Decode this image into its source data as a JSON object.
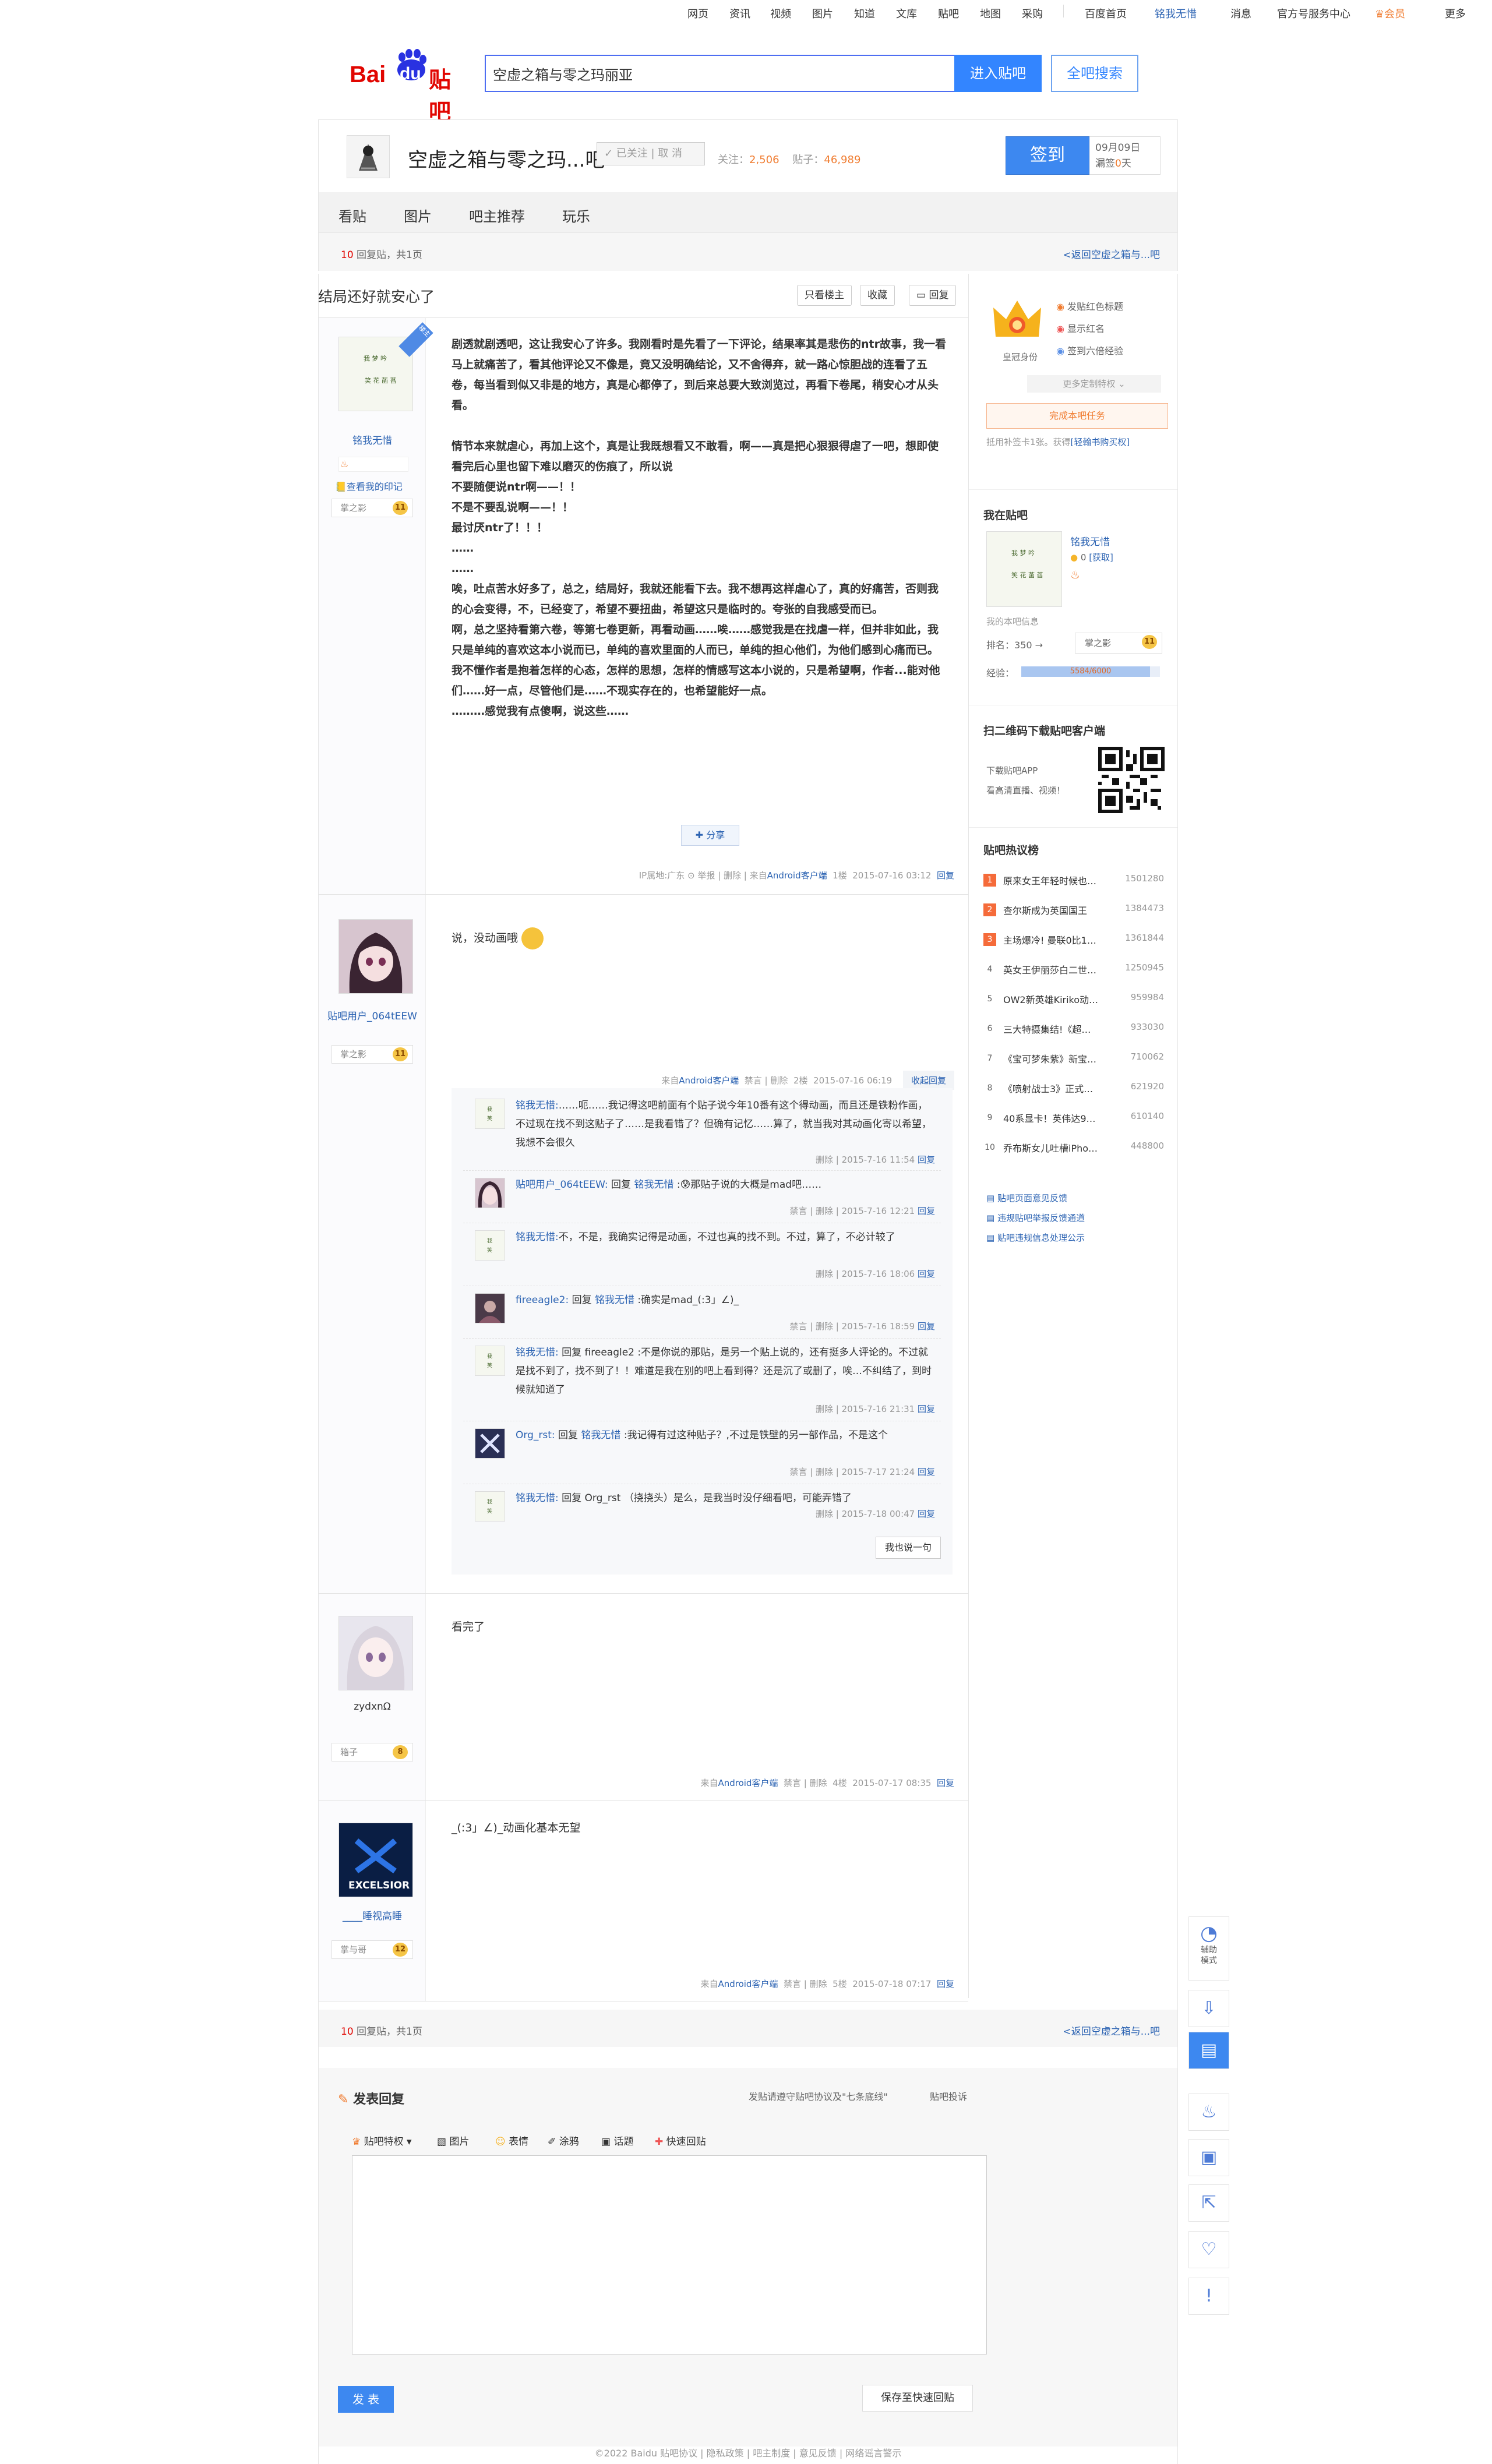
{
  "topnav": {
    "items": [
      "网页",
      "资讯",
      "视频",
      "图片",
      "知道",
      "文库",
      "贴吧",
      "地图",
      "采购"
    ],
    "right": [
      "百度首页",
      "铭我无惜",
      "消息",
      "官方号服务中心",
      "会员",
      "更多"
    ]
  },
  "header": {
    "logo_bai": "Bai",
    "logo_du": "du",
    "logo_tieba": "贴吧",
    "search_value": "空虚之箱与零之玛丽亚",
    "enter_btn": "进入贴吧",
    "all_btn": "全吧搜索"
  },
  "forum": {
    "name": "空虚之箱与零之玛...吧",
    "followed": "✓ 已关注 | 取 消",
    "follow_label": "关注：",
    "follow_count": "2,506",
    "post_label": "贴子：",
    "post_count": "46,989",
    "sign_btn": "签到",
    "sign_date": "09月09日",
    "sign_missed_prefix": "漏签",
    "sign_missed_days": "0",
    "sign_missed_suffix": "天",
    "tabs": [
      "看贴",
      "图片",
      "吧主推荐",
      "玩乐"
    ]
  },
  "pager": {
    "count_num": "10",
    "count_text": " 回复贴，共1页",
    "back": "<返回空虚之箱与...吧"
  },
  "thread": {
    "title": "结局还好就安心了",
    "btn_lz": "只看楼主",
    "btn_fav": "收藏",
    "btn_reply": "回复"
  },
  "posts": [
    {
      "user": "铭我无惜",
      "badge": "楼主",
      "diary": "查看我的印记",
      "level_name": "掌之影",
      "level": "11",
      "lines": [
        "剧透就剧透吧，这让我安心了许多。我刚看时是先看了一下评论，结果率其是悲伤的ntr故事，我一看马上就痛苦了，看其他评论又不像是，竟又没明确结论，又不舍得弃，就一路心惊胆战的连看了五卷，每当看到似又非是的地方，真是心都停了，到后来总要大致浏览过，再看下卷尾，稍安心才从头看。",
        "",
        "情节本来就虐心，再加上这个，真是让我既想看又不敢看，啊——真是把心狠狠得虐了一吧，想即使看完后心里也留下难以磨灭的伤痕了，所以说",
        "不要随便说ntr啊——！！",
        "不是不要乱说啊——！！",
        "最讨厌ntr了！！！",
        "……",
        "……",
        "唉，吐点苦水好多了，总之，结局好，我就还能看下去。我不想再这样虐心了，真的好痛苦，否则我的心会变得，不，已经变了，希望不要扭曲，希望这只是临时的。夸张的自我感受而已。",
        "啊，总之坚持看第六卷，等第七卷更新，再看动画……唉……感觉我是在找虐一样，但并非如此，我只是单纯的喜欢这本小说而已，单纯的喜欢里面的人而已，单纯的担心他们，为他们感到心痛而已。",
        "我不懂作者是抱着怎样的心态，怎样的思想，怎样的情感写这本小说的，只是希望啊，作者...能对他们……好一点，尽管他们是……不现实存在的，也希望能好一点。",
        "………感觉我有点傻啊，说这些……"
      ],
      "share": "分享",
      "meta": "IP属地:广东",
      "meta_report": "举报",
      "meta_delete": "删除",
      "meta_client_pre": "来自",
      "meta_client": "Android客户端",
      "meta_floor": "1楼",
      "meta_time": "2015-07-16 03:12",
      "meta_reply": "回复"
    },
    {
      "user": "贴吧用户_064tEEW",
      "level_name": "掌之影",
      "level": "11",
      "text": "说，没动画哦",
      "meta_client_pre": "来自",
      "meta_client": "Android客户端",
      "meta_ban": "禁言",
      "meta_delete": "删除",
      "meta_floor": "2楼",
      "meta_time": "2015-07-16 06:19",
      "meta_collapse": "收起回复"
    },
    {
      "user": "zydxnΩ",
      "level_name": "箱子",
      "level": "8",
      "text": "看完了",
      "meta_client_pre": "来自",
      "meta_client": "Android客户端",
      "meta_ban": "禁言",
      "meta_delete": "删除",
      "meta_floor": "4楼",
      "meta_time": "2015-07-17 08:35",
      "meta_reply": "回复"
    },
    {
      "user": "____睡视高睡",
      "level_name": "掌与哥",
      "level": "12",
      "text": "_(:3」∠)_动画化基本无望",
      "meta_client_pre": "来自",
      "meta_client": "Android客户端",
      "meta_ban": "禁言",
      "meta_delete": "删除",
      "meta_floor": "5楼",
      "meta_time": "2015-07-18 07:17",
      "meta_reply": "回复"
    }
  ],
  "lzl": {
    "items": [
      {
        "user": "铭我无惜:",
        "text": "……呃……我记得这吧前面有个贴子说今年10番有这个得动画，而且还是铁粉作画，不过现在找不到这贴子了……是我看错了？但确有记忆……算了，就当我对其动画化寄以希望，我想不会很久",
        "time": "2015-7-16 11:54",
        "actions": "删除 |",
        "reply": "回复"
      },
      {
        "user": "贴吧用户_064tEEW:",
        "pre": " 回复 ",
        "to": "铭我无惜",
        "text": " :😰那贴子说的大概是mad吧……",
        "time": "2015-7-16 12:21",
        "actions": "禁言 | 删除 |",
        "reply": "回复"
      },
      {
        "user": "铭我无惜:",
        "text": "不，不是，我确实记得是动画，不过也真的找不到。不过，算了，不必计较了",
        "time": "2015-7-16 18:06",
        "actions": "删除 |",
        "reply": "回复"
      },
      {
        "user": "fireeagle2:",
        "pre": " 回复 ",
        "to": "铭我无惜",
        "text": " :确实是mad_(:3」∠)_",
        "time": "2015-7-16 18:59",
        "actions": "禁言 | 删除 |",
        "reply": "回复"
      },
      {
        "user": "铭我无惜:",
        "pre": " 回复 fireeagle2 :",
        "text": "不是你说的那贴，是另一个贴上说的，还有挺多人评论的。不过就是找不到了，找不到了！！难道是我在别的吧上看到得？还是沉了或删了，唉…不纠结了，到时候就知道了",
        "time": "2015-7-16 21:31",
        "actions": "删除 |",
        "reply": "回复"
      },
      {
        "user": "Org_rst:",
        "pre": " 回复 ",
        "to": "铭我无惜",
        "text": " :我记得有过这种贴子？,不过是铁壁的另一部作品，不是这个",
        "time": "2015-7-17 21:24",
        "actions": "禁言 | 删除 |",
        "reply": "回复"
      },
      {
        "user": "铭我无惜:",
        "pre": " 回复 Org_rst （挠挠头）是么，是我当时没仔细看吧，可能弄错了",
        "text": "",
        "time": "2015-7-18 00:47",
        "actions": "删除 |",
        "reply": "回复"
      }
    ],
    "say_btn": "我也说一句"
  },
  "sidebar": {
    "vip_items": [
      "发贴红色标题",
      "显示红名",
      "签到六倍经验"
    ],
    "vip_label": "皇冠身份",
    "more_priv": "更多定制特权 ⌄",
    "do_task": "完成本吧任务",
    "buy_text": "抵用补签卡1张。获得",
    "buy_link": "[轻翰书购买权]",
    "me_title": "我在贴吧",
    "me_name": "铭我无惜",
    "me_coin": "0",
    "me_coin_get": "[获取]",
    "me_info": "我的本吧信息",
    "rank_label": "排名：",
    "rank": "350",
    "rank_arrow": "→",
    "level_name": "掌之影",
    "level": "11",
    "exp_label": "经验：",
    "exp_text": "5584/6000",
    "exp_fraction": 0.93,
    "qr_title": "扫二维码下载贴吧客户端",
    "qr_line1": "下载贴吧APP",
    "qr_line2": "看高清直播、视频！",
    "hot_title": "贴吧热议榜",
    "hot": [
      {
        "n": "1",
        "t": "原来女王年轻时候也…",
        "c": "1501280"
      },
      {
        "n": "2",
        "t": "查尔斯成为英国国王",
        "c": "1384473"
      },
      {
        "n": "3",
        "t": "主场爆冷! 曼联0比1…",
        "c": "1361844"
      },
      {
        "n": "4",
        "t": "英女王伊丽莎白二世…",
        "c": "1250945"
      },
      {
        "n": "5",
        "t": "OW2新英雄Kiriko动…",
        "c": "959984"
      },
      {
        "n": "6",
        "t": "三大特摄集结!《超…",
        "c": "933030"
      },
      {
        "n": "7",
        "t": "《宝可梦朱紫》新宝…",
        "c": "710062"
      },
      {
        "n": "8",
        "t": "《喷射战士3》正式…",
        "c": "621920"
      },
      {
        "n": "9",
        "t": "40系显卡！英伟达9…",
        "c": "610140"
      },
      {
        "n": "10",
        "t": "乔布斯女儿吐槽iPho…",
        "c": "448800"
      }
    ],
    "links": [
      "贴吧页面意见反馈",
      "违规贴吧举报反馈通道",
      "贴吧违规信息处理公示"
    ]
  },
  "reply": {
    "title": "发表回复",
    "rule_link": "发贴请遵守贴吧协议及\"七条底线\"",
    "complain": "贴吧投诉",
    "tools": [
      "贴吧特权 ▾",
      "图片",
      "表情",
      "涂鸦",
      "话题",
      "快速回贴"
    ],
    "post_btn": "发 表",
    "save_btn": "保存至快速回贴"
  },
  "footer": "©2022 Baidu 贴吧协议 | 隐私政策 | 吧主制度 | 意见反馈 | 网络谣言警示",
  "floatbar": {
    "assist": "辅助\n模式"
  }
}
